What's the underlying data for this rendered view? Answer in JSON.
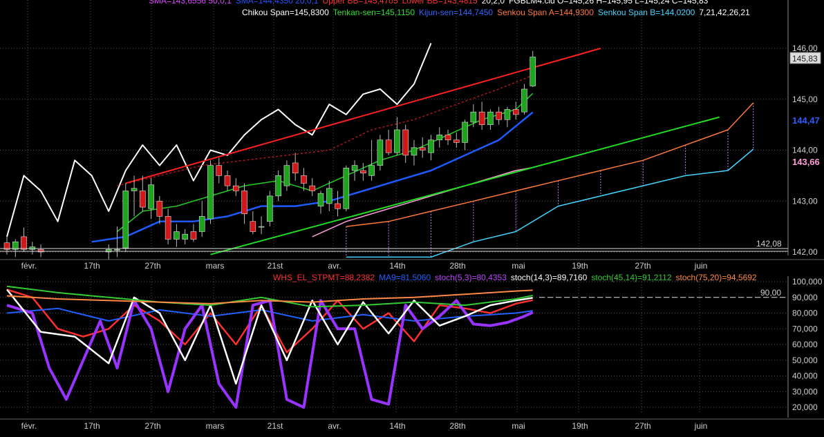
{
  "colors": {
    "background": "#000000",
    "axis_text": "#cfcfcf",
    "grid": "#555555",
    "candle_up": "#1fa31f",
    "candle_down": "#d01818",
    "chikou": "#ffffff",
    "tenkan": "#22cc22",
    "kijun": "#1e5bff",
    "senkou_a": "#ff7a3a",
    "senkou_b": "#44d6ff",
    "upper_bb": "#b0161a",
    "lower_bb": "#b0161a",
    "sma": "#ff9ddc",
    "trend_red": "#ff2020",
    "trend_green": "#22dd22",
    "whs": "#ff3030",
    "ma9": "#2060ff",
    "stoch_5_3": "#9933ff",
    "stoch_14_3": "#ffffff",
    "stoch_45_14": "#33cc33",
    "stoch_75_20": "#ff8844"
  },
  "header": {
    "line1": [
      {
        "text": "SMA=143,6556  50,0,1",
        "color": "#dd44ff"
      },
      {
        "text": "SMA=144,4350  20,0,1",
        "color": "#2255ff"
      },
      {
        "text": "Upper BB=145,4705",
        "color": "#ff3030"
      },
      {
        "text": "Lower BB=143,4815",
        "color": "#ff3030"
      },
      {
        "text": "20,2,0",
        "color": "#ffffff"
      },
      {
        "text": "FGBLM4.cld O=145,26 H=145,95 L=145,24 C=145,83",
        "color": "#ffffff"
      }
    ],
    "line2": [
      {
        "text": "Chikou Span=145,8300",
        "color": "#ffffff"
      },
      {
        "text": "Tenkan-sen=145,1150",
        "color": "#33dd33"
      },
      {
        "text": "Kijun-sen=144,7450",
        "color": "#3366ff"
      },
      {
        "text": "Senkou Span A=144,9300",
        "color": "#ff7a3a"
      },
      {
        "text": "Senkou Span B=144,0200",
        "color": "#44d6ff"
      },
      {
        "text": "7,21,42,26,21",
        "color": "#ffffff"
      }
    ]
  },
  "price_panel": {
    "y_ticks": [
      "146,00",
      "145,00",
      "144,00",
      "143,00",
      "142,00"
    ],
    "last_price_label": "145,83",
    "kijun_label": "144,47",
    "sma_label": "143,66",
    "low_marker_label": "142,08"
  },
  "x_axis_labels": [
    "févr.",
    "17th",
    "27th",
    "mars",
    "21st",
    "avr.",
    "14th",
    "28th",
    "mai",
    "19th",
    "27th",
    "juin"
  ],
  "osc_panel": {
    "legend": [
      {
        "text": "WHS_EL_STPMT=88,2382",
        "color": "#ff3030"
      },
      {
        "text": "MA9=81,5060",
        "color": "#2060ff"
      },
      {
        "text": "stoch(5,3)=80,4353",
        "color": "#bb44ff"
      },
      {
        "text": "stoch(14,3)=89,7160",
        "color": "#ffffff"
      },
      {
        "text": "stoch(45,14)=91,2112",
        "color": "#33cc33"
      },
      {
        "text": "stoch(75,20)=94,5692",
        "color": "#ff8844"
      }
    ],
    "y_ticks": [
      "100,000",
      "90,000",
      "80,000",
      "70,000",
      "60,000",
      "50,000",
      "40,000",
      "30,000",
      "20,000"
    ],
    "reference_level": "90,00"
  },
  "chart_data": [
    {
      "type": "candlestick",
      "title": "FGBLM4.cld",
      "ylim": [
        142.0,
        146.2
      ],
      "x_index_range": [
        0,
        100
      ],
      "candles": [
        {
          "i": 0,
          "o": 142.18,
          "h": 142.3,
          "l": 141.95,
          "c": 142.05
        },
        {
          "i": 1,
          "o": 142.05,
          "h": 142.25,
          "l": 141.9,
          "c": 142.2
        },
        {
          "i": 2,
          "o": 142.3,
          "h": 142.48,
          "l": 142.0,
          "c": 142.05
        },
        {
          "i": 3,
          "o": 142.05,
          "h": 142.2,
          "l": 141.95,
          "c": 142.1
        },
        {
          "i": 4,
          "o": 142.05,
          "h": 142.15,
          "l": 141.9,
          "c": 142.0
        },
        {
          "i": 12,
          "o": 142.0,
          "h": 142.15,
          "l": 141.85,
          "c": 142.05
        },
        {
          "i": 13,
          "o": 142.05,
          "h": 142.5,
          "l": 141.9,
          "c": 142.05
        },
        {
          "i": 14,
          "o": 142.08,
          "h": 143.35,
          "l": 142.0,
          "c": 143.2
        },
        {
          "i": 15,
          "o": 143.2,
          "h": 143.5,
          "l": 142.7,
          "c": 143.25
        },
        {
          "i": 16,
          "o": 143.2,
          "h": 143.5,
          "l": 142.8,
          "c": 142.88
        },
        {
          "i": 17,
          "o": 142.85,
          "h": 143.45,
          "l": 142.65,
          "c": 143.32
        },
        {
          "i": 18,
          "o": 143.0,
          "h": 143.1,
          "l": 142.55,
          "c": 142.7
        },
        {
          "i": 19,
          "o": 142.7,
          "h": 142.85,
          "l": 142.15,
          "c": 142.25
        },
        {
          "i": 20,
          "o": 142.25,
          "h": 142.55,
          "l": 142.1,
          "c": 142.4
        },
        {
          "i": 21,
          "o": 142.25,
          "h": 142.45,
          "l": 142.15,
          "c": 142.35
        },
        {
          "i": 22,
          "o": 142.4,
          "h": 142.55,
          "l": 142.2,
          "c": 142.25
        },
        {
          "i": 23,
          "o": 142.4,
          "h": 143.0,
          "l": 142.3,
          "c": 142.7
        },
        {
          "i": 24,
          "o": 142.65,
          "h": 143.8,
          "l": 142.55,
          "c": 143.7
        },
        {
          "i": 25,
          "o": 143.7,
          "h": 143.85,
          "l": 143.35,
          "c": 143.5
        },
        {
          "i": 26,
          "o": 143.5,
          "h": 143.6,
          "l": 143.2,
          "c": 143.3
        },
        {
          "i": 27,
          "o": 143.3,
          "h": 143.45,
          "l": 143.1,
          "c": 143.2
        },
        {
          "i": 28,
          "o": 143.2,
          "h": 143.35,
          "l": 142.55,
          "c": 142.75
        },
        {
          "i": 29,
          "o": 142.6,
          "h": 142.8,
          "l": 142.35,
          "c": 142.4
        },
        {
          "i": 30,
          "o": 142.5,
          "h": 142.7,
          "l": 142.35,
          "c": 142.5
        },
        {
          "i": 31,
          "o": 142.6,
          "h": 143.2,
          "l": 142.5,
          "c": 143.1
        },
        {
          "i": 32,
          "o": 143.1,
          "h": 143.6,
          "l": 143.0,
          "c": 143.5
        },
        {
          "i": 33,
          "o": 143.3,
          "h": 143.8,
          "l": 143.2,
          "c": 143.7
        },
        {
          "i": 34,
          "o": 143.75,
          "h": 143.95,
          "l": 143.4,
          "c": 143.55
        },
        {
          "i": 35,
          "o": 143.5,
          "h": 143.65,
          "l": 143.2,
          "c": 143.35
        },
        {
          "i": 36,
          "o": 143.3,
          "h": 143.45,
          "l": 143.1,
          "c": 143.2
        },
        {
          "i": 37,
          "o": 142.9,
          "h": 143.2,
          "l": 142.75,
          "c": 143.15
        },
        {
          "i": 38,
          "o": 142.95,
          "h": 143.4,
          "l": 142.8,
          "c": 143.25
        },
        {
          "i": 39,
          "o": 142.95,
          "h": 143.2,
          "l": 142.7,
          "c": 142.85
        },
        {
          "i": 40,
          "o": 142.85,
          "h": 143.7,
          "l": 142.8,
          "c": 143.65
        },
        {
          "i": 41,
          "o": 143.6,
          "h": 143.8,
          "l": 143.4,
          "c": 143.7
        },
        {
          "i": 42,
          "o": 143.6,
          "h": 143.75,
          "l": 143.4,
          "c": 143.55
        },
        {
          "i": 43,
          "o": 143.5,
          "h": 144.2,
          "l": 143.4,
          "c": 143.7
        },
        {
          "i": 44,
          "o": 143.7,
          "h": 144.3,
          "l": 143.6,
          "c": 144.2
        },
        {
          "i": 45,
          "o": 144.2,
          "h": 144.4,
          "l": 143.9,
          "c": 143.95
        },
        {
          "i": 46,
          "o": 143.95,
          "h": 144.65,
          "l": 143.9,
          "c": 144.4
        },
        {
          "i": 47,
          "o": 144.4,
          "h": 144.5,
          "l": 143.75,
          "c": 143.9
        },
        {
          "i": 48,
          "o": 143.9,
          "h": 144.2,
          "l": 143.7,
          "c": 144.05
        },
        {
          "i": 49,
          "o": 144.05,
          "h": 144.25,
          "l": 143.85,
          "c": 144.0
        },
        {
          "i": 50,
          "o": 143.95,
          "h": 144.3,
          "l": 143.8,
          "c": 144.2
        },
        {
          "i": 51,
          "o": 144.2,
          "h": 144.45,
          "l": 144.05,
          "c": 144.3
        },
        {
          "i": 52,
          "o": 144.3,
          "h": 144.4,
          "l": 144.1,
          "c": 144.2
        },
        {
          "i": 53,
          "o": 144.2,
          "h": 144.35,
          "l": 144.05,
          "c": 144.15
        },
        {
          "i": 54,
          "o": 144.15,
          "h": 144.6,
          "l": 144.0,
          "c": 144.55
        },
        {
          "i": 55,
          "o": 144.55,
          "h": 144.9,
          "l": 144.45,
          "c": 144.75
        },
        {
          "i": 56,
          "o": 144.75,
          "h": 144.95,
          "l": 144.4,
          "c": 144.5
        },
        {
          "i": 57,
          "o": 144.5,
          "h": 144.8,
          "l": 144.4,
          "c": 144.75
        },
        {
          "i": 58,
          "o": 144.75,
          "h": 144.85,
          "l": 144.5,
          "c": 144.6
        },
        {
          "i": 59,
          "o": 144.6,
          "h": 144.85,
          "l": 144.45,
          "c": 144.8
        },
        {
          "i": 60,
          "o": 144.8,
          "h": 144.95,
          "l": 144.6,
          "c": 144.7
        },
        {
          "i": 61,
          "o": 144.75,
          "h": 145.3,
          "l": 144.7,
          "c": 145.2
        },
        {
          "i": 62,
          "o": 145.26,
          "h": 145.95,
          "l": 145.24,
          "c": 145.83
        }
      ]
    },
    {
      "type": "line",
      "title": "Ichimoku / Bollinger / SMA overlays",
      "ylim": [
        142.0,
        146.2
      ],
      "series": [
        {
          "name": "Chikou Span",
          "x": [
            0,
            2,
            4,
            6,
            8,
            10,
            12,
            14,
            16,
            18,
            20,
            22,
            24,
            26,
            28,
            30,
            32,
            34,
            36,
            38,
            40,
            42,
            44,
            46,
            48,
            50
          ],
          "values": [
            142.3,
            143.5,
            143.2,
            142.6,
            143.8,
            143.5,
            142.8,
            143.6,
            144.1,
            143.7,
            144.1,
            143.4,
            144.0,
            143.9,
            144.3,
            144.6,
            144.8,
            144.5,
            144.3,
            144.9,
            144.7,
            145.1,
            145.2,
            144.9,
            145.3,
            146.1
          ]
        },
        {
          "name": "Tenkan-sen",
          "x": [
            13,
            16,
            20,
            24,
            28,
            32,
            36,
            40,
            44,
            48,
            52,
            56,
            60,
            62
          ],
          "values": [
            142.4,
            142.8,
            142.9,
            143.1,
            143.3,
            143.4,
            143.2,
            143.5,
            143.8,
            144.0,
            144.3,
            144.6,
            144.8,
            145.115
          ]
        },
        {
          "name": "Kijun-sen",
          "x": [
            10,
            14,
            18,
            22,
            26,
            30,
            34,
            38,
            42,
            46,
            50,
            54,
            58,
            62
          ],
          "values": [
            142.2,
            142.3,
            142.6,
            142.6,
            142.7,
            142.9,
            142.9,
            143.0,
            143.2,
            143.4,
            143.6,
            143.9,
            144.2,
            144.745
          ]
        },
        {
          "name": "Senkou Span A",
          "x": [
            40,
            45,
            50,
            55,
            60,
            65,
            70,
            75,
            80,
            85,
            88
          ],
          "values": [
            142.5,
            142.6,
            142.8,
            143.0,
            143.2,
            143.4,
            143.6,
            143.8,
            144.1,
            144.4,
            144.93
          ]
        },
        {
          "name": "Senkou Span B",
          "x": [
            40,
            45,
            50,
            55,
            60,
            65,
            70,
            75,
            80,
            85,
            88
          ],
          "values": [
            141.9,
            141.9,
            141.9,
            142.2,
            142.4,
            142.9,
            143.1,
            143.3,
            143.5,
            143.6,
            144.02
          ]
        },
        {
          "name": "Upper BB",
          "x": [
            13,
            18,
            23,
            28,
            33,
            38,
            43,
            48,
            53,
            58,
            62
          ],
          "values": [
            143.3,
            143.5,
            143.7,
            143.8,
            143.9,
            144.0,
            144.4,
            144.6,
            144.9,
            145.2,
            145.47
          ]
        },
        {
          "name": "SMA 50",
          "x": [
            36,
            40,
            44,
            48,
            52,
            56,
            60,
            62
          ],
          "values": [
            142.3,
            142.6,
            142.8,
            143.0,
            143.2,
            143.4,
            143.6,
            143.66
          ]
        }
      ]
    },
    {
      "type": "line",
      "title": "Trend lines",
      "series": [
        {
          "name": "Resistance",
          "x": [
            14,
            70
          ],
          "values": [
            143.35,
            146.0
          ]
        },
        {
          "name": "Support",
          "x": [
            24,
            84
          ],
          "values": [
            141.95,
            144.65
          ]
        }
      ]
    },
    {
      "type": "line",
      "title": "Oscillators",
      "ylim": [
        15,
        105
      ],
      "x_index_range": [
        0,
        100
      ],
      "series": [
        {
          "name": "WHS_EL_STPMT",
          "x": [
            0,
            3,
            6,
            9,
            12,
            15,
            18,
            21,
            24,
            27,
            30,
            33,
            36,
            39,
            42,
            45,
            48,
            51,
            54,
            57,
            60,
            62
          ],
          "values": [
            95,
            90,
            70,
            65,
            70,
            85,
            75,
            60,
            80,
            60,
            85,
            55,
            70,
            88,
            70,
            80,
            62,
            85,
            83,
            80,
            86,
            88.24
          ]
        },
        {
          "name": "MA9",
          "x": [
            0,
            6,
            12,
            18,
            24,
            30,
            36,
            42,
            48,
            54,
            60,
            62
          ],
          "values": [
            80,
            83,
            75,
            82,
            78,
            82,
            75,
            79,
            75,
            78,
            80,
            81.51
          ]
        },
        {
          "name": "stoch(5,3)",
          "x": [
            0,
            3,
            5,
            7,
            9,
            11,
            13,
            15,
            17,
            19,
            21,
            23,
            25,
            27,
            29,
            31,
            33,
            35,
            37,
            39,
            41,
            43,
            45,
            47,
            49,
            51,
            53,
            55,
            57,
            59,
            61,
            62
          ],
          "values": [
            85,
            80,
            45,
            25,
            50,
            75,
            45,
            88,
            70,
            30,
            70,
            85,
            35,
            20,
            85,
            88,
            25,
            20,
            88,
            70,
            70,
            25,
            22,
            85,
            70,
            78,
            88,
            73,
            72,
            74,
            78,
            80.44
          ]
        },
        {
          "name": "stoch(14,3)",
          "x": [
            0,
            4,
            8,
            12,
            15,
            18,
            21,
            24,
            27,
            30,
            33,
            36,
            39,
            42,
            45,
            48,
            51,
            54,
            57,
            60,
            62
          ],
          "values": [
            95,
            68,
            65,
            48,
            90,
            80,
            50,
            85,
            35,
            85,
            50,
            88,
            60,
            87,
            67,
            88,
            72,
            78,
            85,
            88,
            89.72
          ]
        },
        {
          "name": "stoch(45,14)",
          "x": [
            0,
            6,
            12,
            18,
            24,
            30,
            36,
            42,
            48,
            54,
            60,
            62
          ],
          "values": [
            97,
            93,
            90,
            87,
            85,
            90,
            84,
            85,
            87,
            85,
            89,
            91.21
          ]
        },
        {
          "name": "stoch(75,20)",
          "x": [
            0,
            6,
            12,
            18,
            24,
            30,
            36,
            42,
            48,
            54,
            60,
            62
          ],
          "values": [
            91,
            89,
            88,
            87,
            86,
            88,
            87,
            89,
            90,
            92,
            94,
            94.57
          ]
        }
      ]
    }
  ]
}
